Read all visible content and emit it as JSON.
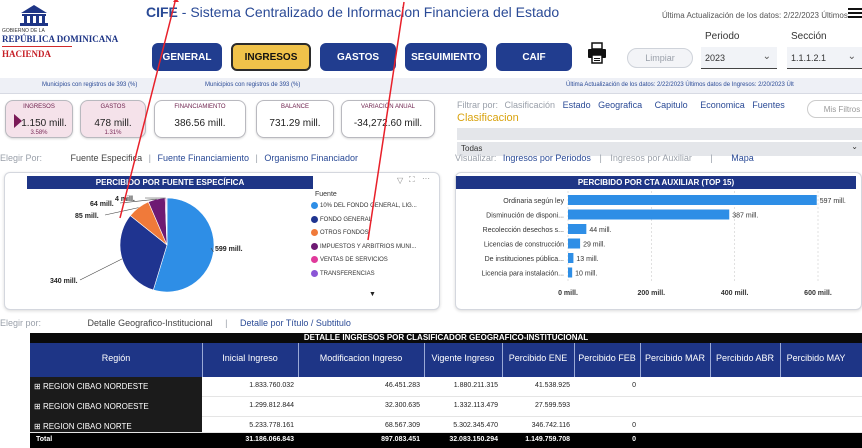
{
  "header": {
    "org_line1": "GOBIERNO DE LA",
    "org_line2": "REPÚBLICA DOMINICANA",
    "org_line3": "HACIENDA",
    "app_acronym": "CIFE",
    "app_title": " - Sistema Centralizado de Informacion Financiera del Estado",
    "update_text": "Última Actualización de los datos: 2/22/2023 Últimos ...",
    "nav": [
      "GENERAL",
      "INGRESOS",
      "GASTOS",
      "SEGUIMIENTO",
      "CAIF"
    ],
    "limpiar": "Limpiar",
    "periodo_label": "Periodo",
    "periodo_value": "2023",
    "seccion_label": "Sección",
    "seccion_value": "1.1.1.2.1"
  },
  "subline": {
    "left1": "Municipios con registros de 393 (%)",
    "left2": "Municipios con registros de 393 (%)",
    "right": "Última Actualización de los datos: 2/22/2023 Últimos datos de Ingresos: 2/20/2023 Últ"
  },
  "kpis": [
    {
      "title": "INGRESOS",
      "value": "1.150 mill.",
      "pct": "3.58%"
    },
    {
      "title": "GASTOS",
      "value": "478 mill.",
      "pct": "1.31%"
    },
    {
      "title": "FINANCIAMIENTO",
      "value": "386.56 mill.",
      "pct": ""
    },
    {
      "title": "BALANCE",
      "value": "731.29 mill.",
      "pct": ""
    },
    {
      "title": "VARIACIÓN ANUAL",
      "value": "-34,272.60 mill.",
      "pct": ""
    }
  ],
  "filters": {
    "prefix": "Filtrar por:",
    "first": "Clasificación",
    "items": [
      "Estado",
      "Geografica",
      "Capitulo",
      "Economica",
      "Fuentes"
    ],
    "mis_filtros": "Mis Filtros",
    "active": "Clasificacion",
    "todas": "Todas"
  },
  "tabs_left": {
    "prefix": "Elegir Por:",
    "items": [
      "Fuente Especifica",
      "Fuente Financiamiento",
      "Organismo Financiador"
    ]
  },
  "tabs_right": {
    "prefix": "Visualizar:",
    "items": [
      "Ingresos por Periodos",
      "Ingresos por Auxiliar",
      "Mapa"
    ]
  },
  "pie": {
    "title": "PERCIBIDO POR FUENTE ESPECÍFICA",
    "legend_title": "Fuente",
    "chart_data": {
      "type": "pie",
      "slices": [
        {
          "label": "10% DEL FONDO GENERAL, LIG...",
          "value": 599,
          "text": "599 mill.",
          "color": "#2e8ee6"
        },
        {
          "label": "FONDO GENERAL",
          "value": 340,
          "text": "340 mill.",
          "color": "#1f3490"
        },
        {
          "label": "OTROS FONDOS",
          "value": 85,
          "text": "85 mill.",
          "color": "#f07a3a"
        },
        {
          "label": "IMPUESTOS Y ARBITRIOS MUNI...",
          "value": 64,
          "text": "64 mill.",
          "color": "#6e1a73"
        },
        {
          "label": "VENTAS DE SERVICIOS",
          "value": 4,
          "text": "4 mill.",
          "color": "#e03a9b"
        },
        {
          "label": "TRANSFERENCIAS",
          "value": 3,
          "text": "",
          "color": "#8b55d6"
        }
      ]
    }
  },
  "bars": {
    "title": "PERCIBIDO POR CTA AUXILIAR (TOP 15)",
    "chart_data": {
      "type": "bar",
      "orientation": "horizontal",
      "categories": [
        "Ordinaria según ley",
        "Disminución de disponi...",
        "Recolección desechos s...",
        "Licencias de construcción",
        "De instituciones pública...",
        "Licencia para instalación..."
      ],
      "values": [
        597,
        387,
        44,
        29,
        13,
        10
      ],
      "value_labels": [
        "597 mill.",
        "387 mill.",
        "44 mill.",
        "29 mill.",
        "13 mill.",
        "10 mill."
      ],
      "xticks": [
        "0 mill.",
        "200 mill.",
        "400 mill.",
        "600 mill."
      ],
      "xlim": [
        0,
        600
      ],
      "color": "#2e8ee6"
    }
  },
  "tabs_bottom": {
    "prefix": "Elegir por:",
    "items": [
      "Detalle Geografico-Institucional",
      "Detalle por Título / Subtitulo"
    ]
  },
  "table": {
    "title": "DETALLE INGRESOS POR CLASIFICADOR GEOGRAFICO-INSTITUCIONAL",
    "headers": [
      "Región",
      "Inicial Ingreso",
      "Modificacion Ingreso",
      "Vigente Ingreso",
      "Percibido ENE",
      "Percibido FEB",
      "Percibido MAR",
      "Percibido ABR",
      "Percibido MAY"
    ],
    "rows": [
      {
        "name": "REGION CIBAO NORDESTE",
        "vals": [
          "1.833.760.032",
          "46.451.283",
          "1.880.211.315",
          "41.538.925",
          "0",
          "",
          "",
          ""
        ]
      },
      {
        "name": "REGION CIBAO NOROESTE",
        "vals": [
          "1.299.812.844",
          "32.300.635",
          "1.332.113.479",
          "27.599.593",
          "",
          "",
          "",
          ""
        ]
      },
      {
        "name": "REGION CIBAO NORTE",
        "vals": [
          "5.233.778.161",
          "68.567.309",
          "5.302.345.470",
          "346.742.116",
          "0",
          "",
          "",
          ""
        ]
      }
    ],
    "total": {
      "name": "Total",
      "vals": [
        "31.186.066.843",
        "897.083.451",
        "32.083.150.294",
        "1.149.759.708",
        "0",
        "",
        "",
        ""
      ]
    }
  },
  "colors": {
    "navy": "#213d8f",
    "gold": "#f0c24a",
    "arrow": "#e8202a"
  }
}
